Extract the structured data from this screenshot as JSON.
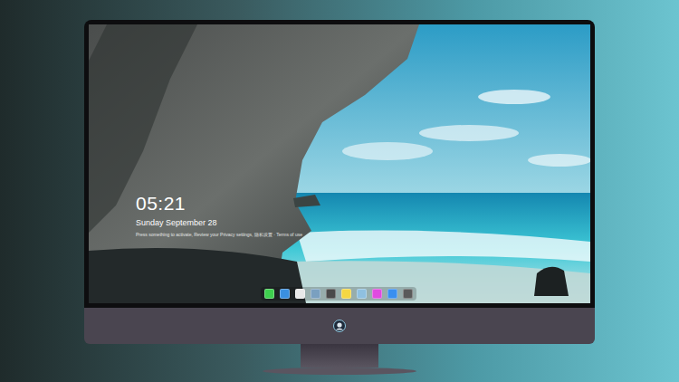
{
  "lock_screen": {
    "time": "05:21",
    "date": "Sunday September 28",
    "message": "Press something to activate, Review your Privacy settings, 隐私设置 · Terms of use"
  },
  "dock": {
    "items": [
      {
        "color": "#3ecf4e"
      },
      {
        "color": "#3a8fe0"
      },
      {
        "color": "#e8e8e8"
      },
      {
        "color": "#7aa0c0"
      },
      {
        "color": "#4a4a4a"
      },
      {
        "color": "#f5d742"
      },
      {
        "color": "#8fc0e0"
      },
      {
        "color": "#e04ae0"
      },
      {
        "color": "#3a8ff0"
      },
      {
        "color": "#5a5a5a"
      }
    ]
  }
}
